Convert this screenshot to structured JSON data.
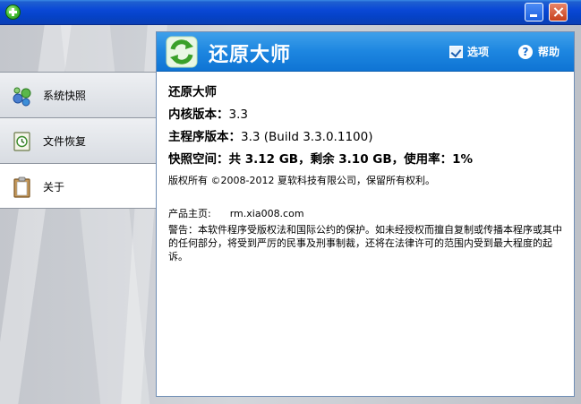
{
  "window": {
    "colors": {
      "titlebar": "#0a48d6",
      "panel_header": "#1d86e0",
      "sidebar_border": "#8f96a0"
    }
  },
  "sidebar": {
    "items": [
      {
        "label": "系统快照",
        "icon": "snapshot-icon",
        "active": false
      },
      {
        "label": "文件恢复",
        "icon": "file-restore-icon",
        "active": false
      },
      {
        "label": "关于",
        "icon": "clipboard-icon",
        "active": true
      }
    ]
  },
  "header": {
    "title": "还原大师",
    "options_label": "选项",
    "help_label": "帮助",
    "help_glyph": "?"
  },
  "about": {
    "product_name": "还原大师",
    "kernel_label": "内核版本：",
    "kernel_value": "3.3",
    "main_label": "主程序版本：",
    "main_value": "3.3 (Build 3.3.0.1100)",
    "snapshot_label": "快照空间：",
    "snapshot_value": "共 3.12 GB，剩余 3.10 GB，使用率：1%",
    "copyright": "版权所有 ©2008-2012 夏软科技有限公司，保留所有权利。",
    "homepage_label": "产品主页:",
    "homepage_url": "rm.xia008.com",
    "warning": "警告：本软件程序受版权法和国际公约的保护。如未经授权而擅自复制或传播本程序或其中的任何部分，将受到严厉的民事及刑事制裁，还将在法律许可的范围内受到最大程度的起诉。"
  }
}
